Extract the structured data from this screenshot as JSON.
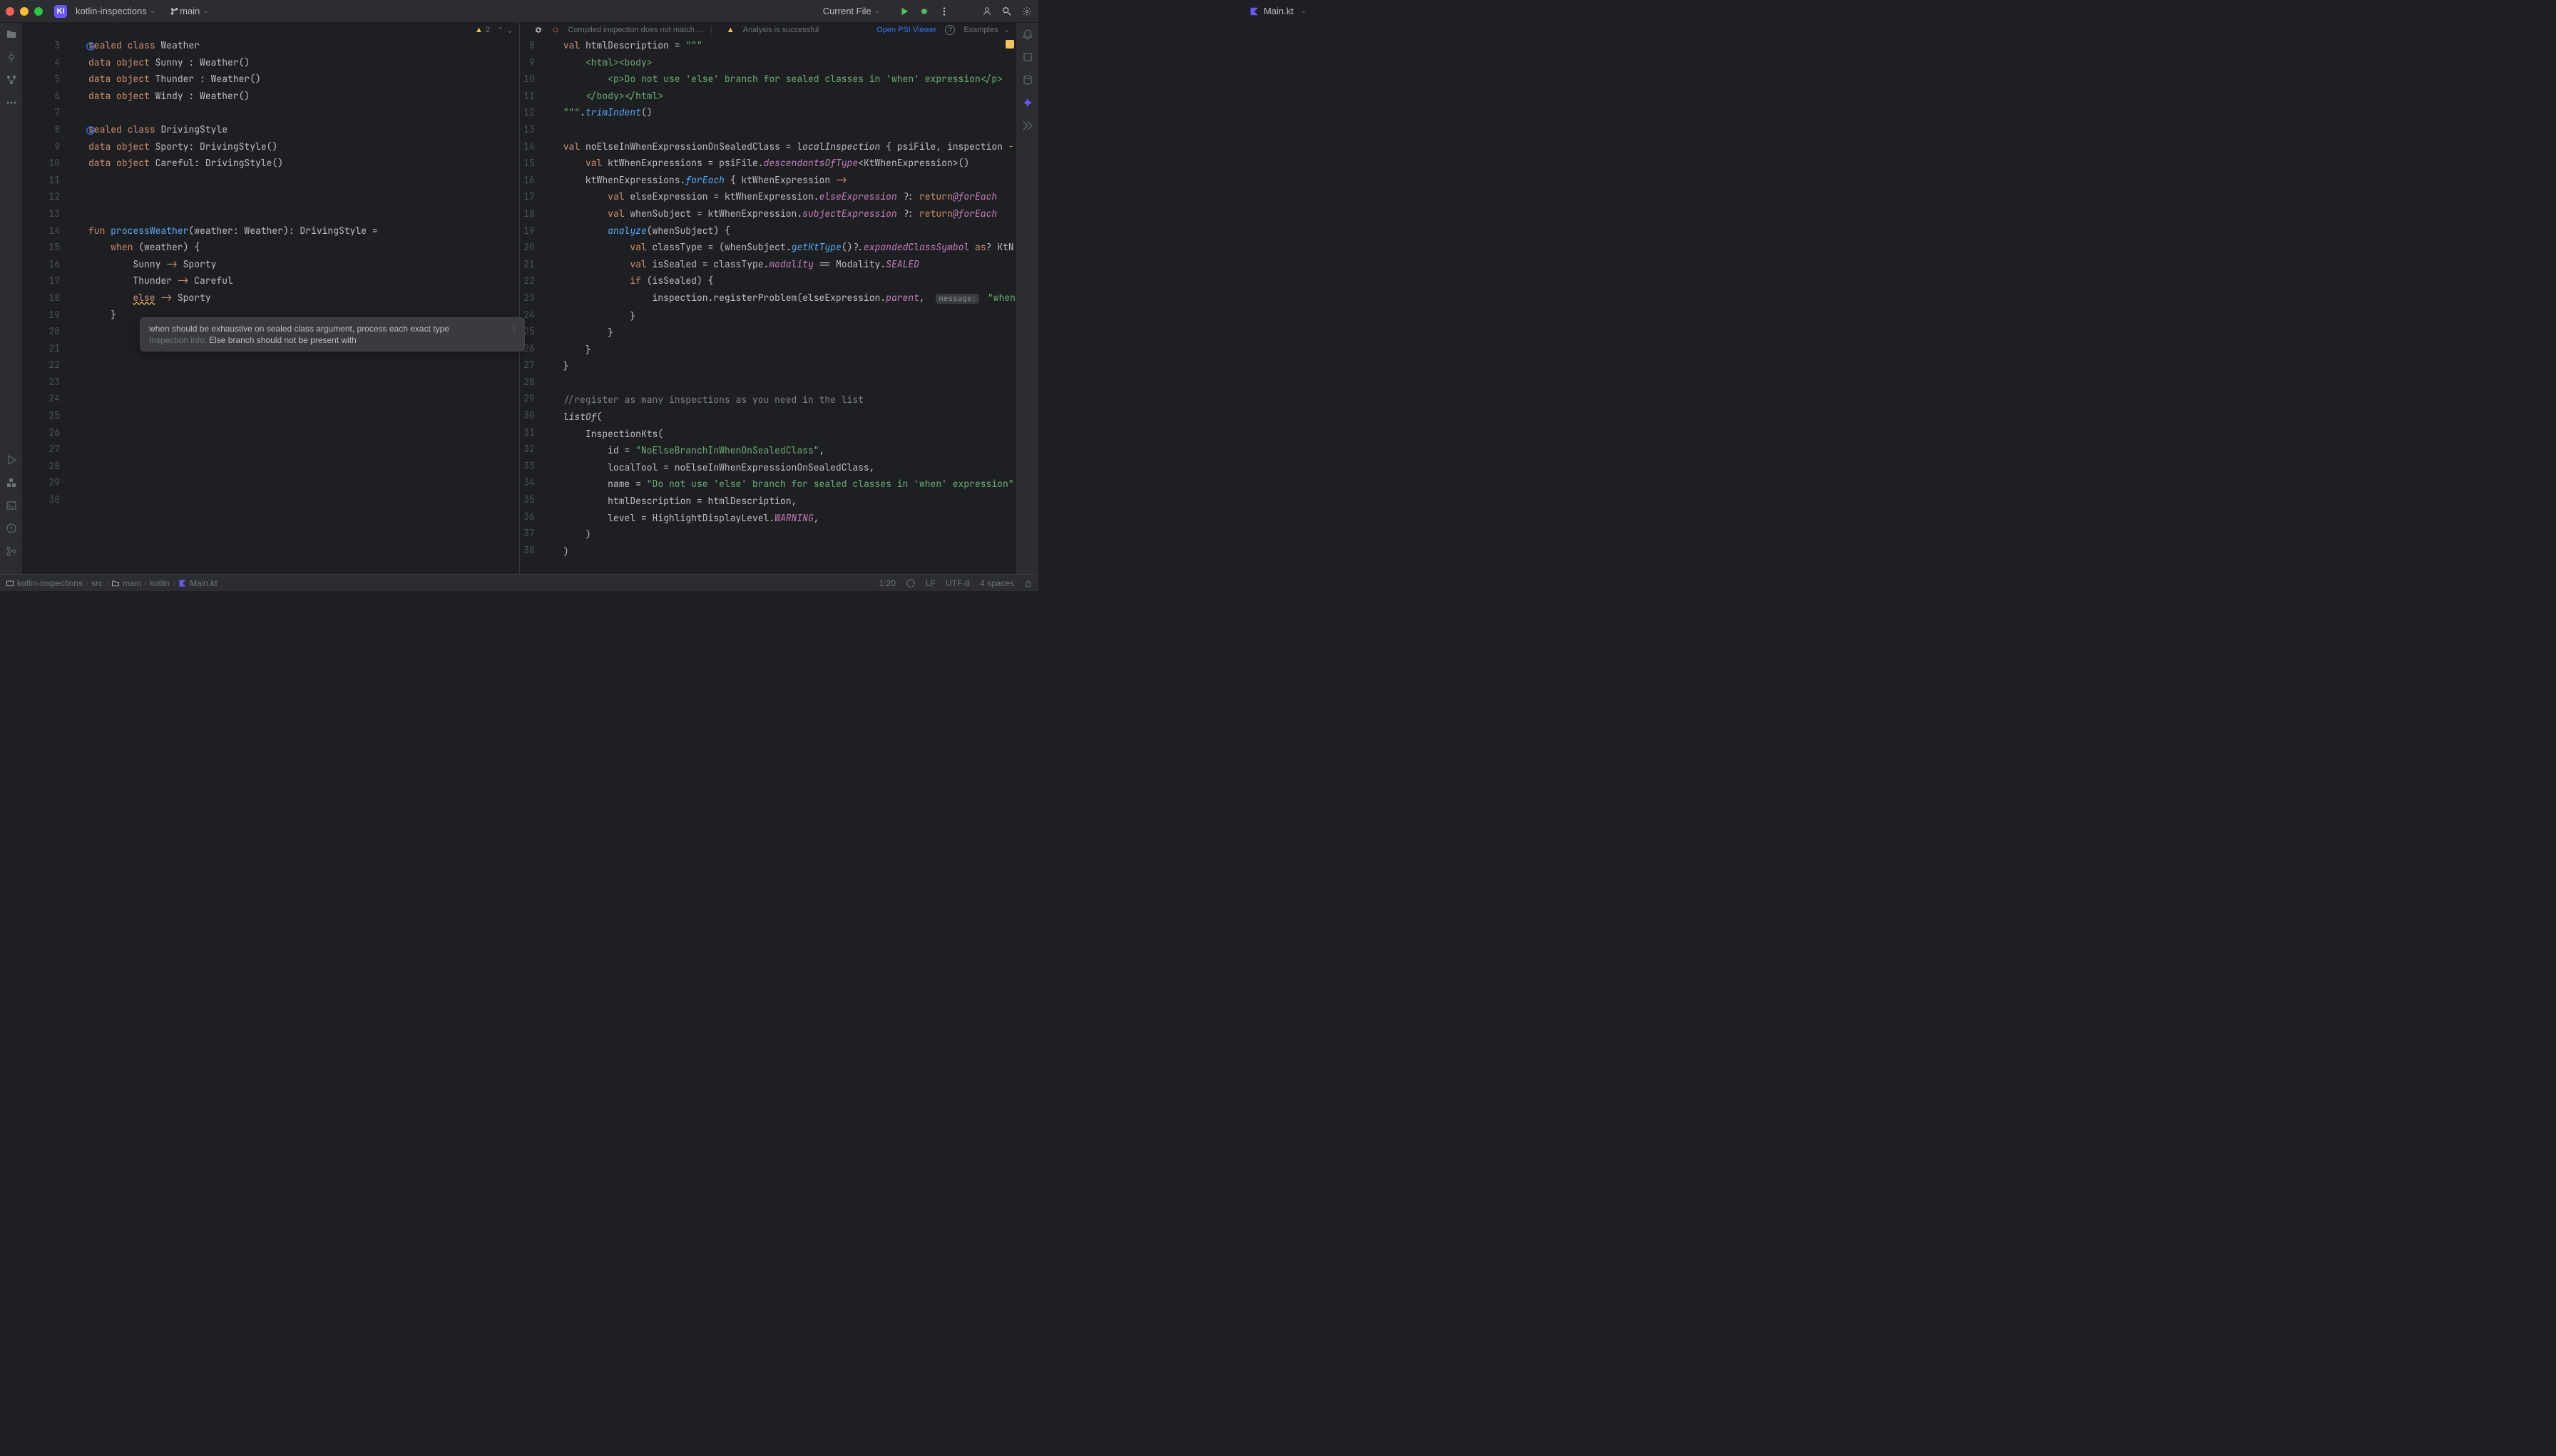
{
  "titlebar": {
    "project_badge": "KI",
    "project_name": "kotlin-inspections",
    "branch_name": "main",
    "current_file": "Main.kt",
    "run_config_label": "Current File"
  },
  "editor_header_left": {
    "warn_count": "2"
  },
  "editor_header_right": {
    "compiled_msg": "Compiled inspection does not match …",
    "analysis_msg": "Analysis is successful",
    "psi_link": "Open PSI Viewer",
    "examples_label": "Examples"
  },
  "left_gutter_start": 3,
  "left_code": [
    {
      "n": 3,
      "html": "<span class='kw'>sealed</span> <span class='kw'>class</span> Weather"
    },
    {
      "n": 4,
      "html": "<span class='kw'>data</span> <span class='kw'>object</span> Sunny : Weather()"
    },
    {
      "n": 5,
      "html": "<span class='kw'>data</span> <span class='kw'>object</span> Thunder : Weather()"
    },
    {
      "n": 6,
      "html": "<span class='kw'>data</span> <span class='kw'>object</span> Windy : Weather()"
    },
    {
      "n": 7,
      "html": ""
    },
    {
      "n": 8,
      "html": "<span class='kw'>sealed</span> <span class='kw'>class</span> DrivingStyle"
    },
    {
      "n": 9,
      "html": "<span class='kw'>data</span> <span class='kw'>object</span> Sporty: DrivingStyle()"
    },
    {
      "n": 10,
      "html": "<span class='kw'>data</span> <span class='kw'>object</span> Careful: DrivingStyle()"
    },
    {
      "n": 11,
      "html": ""
    },
    {
      "n": 12,
      "html": ""
    },
    {
      "n": 13,
      "html": ""
    },
    {
      "n": 14,
      "html": "<span class='kw'>fun</span> <span class='fn'>processWeather</span>(weather: Weather): DrivingStyle ="
    },
    {
      "n": 15,
      "html": "    <span class='kw'>when</span> (weather) {"
    },
    {
      "n": 16,
      "html": "        Sunny <span class='arrow'>-&gt;</span> Sporty"
    },
    {
      "n": 17,
      "html": "        Thunder <span class='arrow'>-&gt;</span> Careful"
    },
    {
      "n": 18,
      "html": "        <span class='kw warn-underline'>else</span> <span class='arrow'>-&gt;</span> Sporty"
    },
    {
      "n": 19,
      "html": "    }"
    },
    {
      "n": 20,
      "html": ""
    },
    {
      "n": 21,
      "html": ""
    },
    {
      "n": 22,
      "html": ""
    },
    {
      "n": 23,
      "html": ""
    },
    {
      "n": 24,
      "html": ""
    },
    {
      "n": 25,
      "html": ""
    },
    {
      "n": 26,
      "html": ""
    },
    {
      "n": 27,
      "html": ""
    },
    {
      "n": 28,
      "html": ""
    },
    {
      "n": 29,
      "html": ""
    },
    {
      "n": 30,
      "html": ""
    }
  ],
  "right_code": [
    {
      "n": 8,
      "html": "<span class='kw'>val</span> htmlDescription = <span class='str'>\"\"\"</span>"
    },
    {
      "n": 9,
      "html": "    <span class='str'>&lt;html&gt;&lt;body&gt;</span>"
    },
    {
      "n": 10,
      "html": "        <span class='str'>&lt;p&gt;Do not use 'else' branch for sealed classes in 'when' expression&lt;/p&gt;</span>"
    },
    {
      "n": 11,
      "html": "    <span class='str'>&lt;/body&gt;&lt;/html&gt;</span>"
    },
    {
      "n": 12,
      "html": "<span class='str'>\"\"\"</span>.<span class='fn it'>trimIndent</span>()"
    },
    {
      "n": 13,
      "html": ""
    },
    {
      "n": 14,
      "html": "<span class='kw'>val</span> noElseInWhenExpressionOnSealedClass = <span class='it'>localInspection</span> { psiFile, inspection <span class='arrow'>-</span>"
    },
    {
      "n": 15,
      "html": "    <span class='kw'>val</span> ktWhenExpressions = psiFile.<span class='it enum'>descendantsOfType</span>&lt;KtWhenExpression&gt;()"
    },
    {
      "n": 16,
      "html": "    ktWhenExpressions.<span class='it fn'>forEach</span> { ktWhenExpression <span class='arrow'>-&gt;</span>"
    },
    {
      "n": 17,
      "html": "        <span class='kw'>val</span> elseExpression = ktWhenExpression.<span class='it enum'>elseExpression</span> ?: <span class='kw'>return</span><span class='enum'>@forEach</span>"
    },
    {
      "n": 18,
      "html": "        <span class='kw'>val</span> whenSubject = ktWhenExpression.<span class='it enum'>subjectExpression</span> ?: <span class='kw'>return</span><span class='enum'>@forEach</span>"
    },
    {
      "n": 19,
      "html": "        <span class='it fn'>analyze</span>(whenSubject) {"
    },
    {
      "n": 20,
      "html": "            <span class='kw'>val</span> classType = (whenSubject.<span class='fn it'>getKtType</span>()?.<span class='it enum'>expandedClassSymbol</span> <span class='kw'>as</span>? KtN"
    },
    {
      "n": 21,
      "html": "            <span class='kw'>val</span> isSealed = classType.<span class='enum'>modality</span> == Modality.<span class='it enum'>SEALED</span>"
    },
    {
      "n": 22,
      "html": "            <span class='kw'>if</span> (isSealed) {"
    },
    {
      "n": 23,
      "html": "                inspection.registerProblem(elseExpression.<span class='it enum'>parent</span>,  <span class='inlay'>message:</span> <span class='str'>\"when</span>"
    },
    {
      "n": 24,
      "html": "            }"
    },
    {
      "n": 25,
      "html": "        }"
    },
    {
      "n": 26,
      "html": "    }"
    },
    {
      "n": 27,
      "html": "}"
    },
    {
      "n": 28,
      "html": ""
    },
    {
      "n": 29,
      "html": "<span class='comment'>//register as many inspections as you need in the list</span>"
    },
    {
      "n": 30,
      "html": "<span class='it'>listOf</span>("
    },
    {
      "n": 31,
      "html": "    InspectionKts("
    },
    {
      "n": 32,
      "html": "        id = <span class='str'>\"NoElseBranchInWhenOnSealedClass\"</span>,"
    },
    {
      "n": 33,
      "html": "        localTool = noElseInWhenExpressionOnSealedClass,"
    },
    {
      "n": 34,
      "html": "        name = <span class='str'>\"Do not use 'else' branch for sealed classes in 'when' expression\"</span>"
    },
    {
      "n": 35,
      "html": "        htmlDescription = htmlDescription,"
    },
    {
      "n": 36,
      "html": "        level = HighlightDisplayLevel.<span class='enum'>WARNING</span>,"
    },
    {
      "n": 37,
      "html": "    )"
    },
    {
      "n": 38,
      "html": ")"
    }
  ],
  "tooltip": {
    "title": "when should be exhaustive on sealed class argument, process each exact type",
    "sub_label": "Inspection info:",
    "sub_text": "Else branch should not be present with"
  },
  "breadcrumbs": {
    "root": "kotlin-inspections",
    "p1": "src",
    "p2": "main",
    "p3": "kotlin",
    "file": "Main.kt"
  },
  "statusbar": {
    "caret": "1:20",
    "line_sep": "LF",
    "encoding": "UTF-8",
    "indent": "4 spaces"
  }
}
